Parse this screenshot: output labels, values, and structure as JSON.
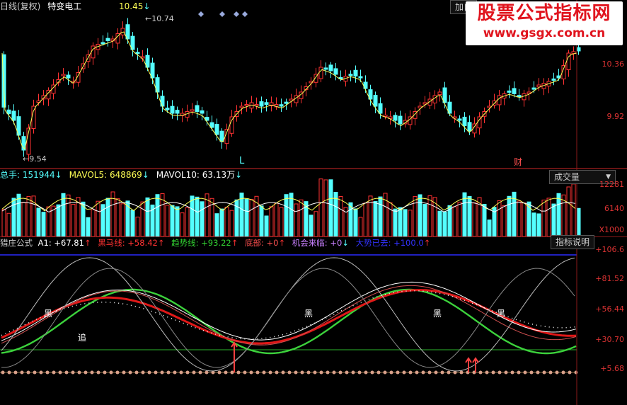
{
  "price": {
    "title": "日线(复权)",
    "stock_name": "特变电工",
    "current_price": "10.45",
    "current_arrow": "↓",
    "high_label": "10.74",
    "low_label": "9.54",
    "axis": [
      "10.36",
      "9.92"
    ],
    "markers": [
      "L",
      "财"
    ],
    "add_button": "加自"
  },
  "volume": {
    "total": "总手: 151944",
    "total_arrow": "↓",
    "mavol5": "MAVOL5: 648869",
    "mavol5_arrow": "↓",
    "mavol10": "MAVOL10: 63.13万",
    "mavol10_arrow": "↓",
    "selector": "成交量",
    "axis": [
      "12281",
      "6140",
      "X1000"
    ]
  },
  "indicator": {
    "name": "猎庄公式",
    "a1": "A1: +67.81",
    "a1_arrow": "↑",
    "heima": "黑马线: +58.42",
    "heima_arrow": "↑",
    "trend": "趋势线: +93.22",
    "trend_arrow": "↑",
    "bottom": "底部: +0",
    "bottom_arrow": "↑",
    "chance": "机会来临: +0",
    "chance_arrow": "↓",
    "gone": "大势已去: +100.0",
    "gone_arrow": "↑",
    "help_button": "指标说明",
    "axis": [
      "+106.6",
      "+81.52",
      "+56.44",
      "+30.70",
      "+5.68"
    ],
    "labels": [
      "黑",
      "追",
      "黑",
      "黑",
      "黑"
    ]
  },
  "watermark": {
    "line1": "股票公式指标网",
    "line2": "www.gsgx.com.cn"
  },
  "colors": {
    "up": "#ff3232",
    "down": "#54ffff",
    "trend_green": "#32d232",
    "heima_red": "#e01818"
  }
}
